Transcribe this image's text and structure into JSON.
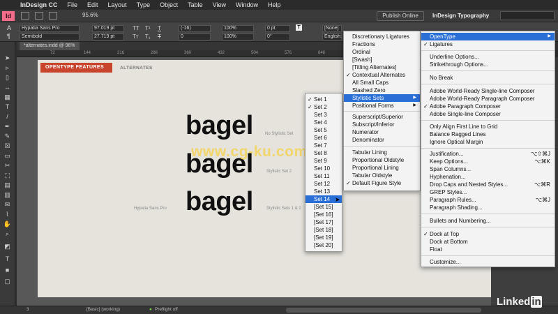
{
  "menubar": {
    "apple": "",
    "items": [
      "InDesign CC",
      "File",
      "Edit",
      "Layout",
      "Type",
      "Object",
      "Table",
      "View",
      "Window",
      "Help"
    ]
  },
  "toolbar": {
    "logo": "Id",
    "zoom": "95.6%",
    "publish_label": "Publish Online",
    "workspace_label": "InDesign Typography"
  },
  "control": {
    "font_family": "Hypatia Sans Pro",
    "font_style": "Semibold",
    "font_size": "97.019 pt",
    "leading": "27.719 pt",
    "kerning": "(-16)",
    "tracking": "0",
    "hscale": "100%",
    "vscale": "100%",
    "baseline": "0 pt",
    "skew": "0°",
    "char_style": "[None]",
    "language": "English: USA"
  },
  "document": {
    "tab_title": "*alternates.indd @ 96%",
    "ruler_marks": [
      "72",
      "144",
      "216",
      "288",
      "360",
      "432",
      "504",
      "576",
      "648",
      "720",
      "792",
      "864"
    ]
  },
  "page": {
    "section_tag": "OPENTYPE FEATURES",
    "section_title": "ALTERNATES",
    "sample_word": "bagel",
    "notes": {
      "row1": "No Stylistic Set",
      "row2": "Stylistic Set 2",
      "row3": "Stylistic Sets 1 & 2",
      "font_caption": "Hypatia Sans Pro"
    }
  },
  "menus": {
    "main": {
      "items": [
        {
          "label": "OpenType",
          "submenu": true,
          "highlighted": true
        },
        {
          "label": "Ligatures",
          "checked": true
        },
        {
          "sep": true
        },
        {
          "label": "Underline Options..."
        },
        {
          "label": "Strikethrough Options..."
        },
        {
          "sep": true
        },
        {
          "label": "No Break"
        },
        {
          "sep": true
        },
        {
          "label": "Adobe World-Ready Single-line Composer"
        },
        {
          "label": "Adobe World-Ready Paragraph Composer"
        },
        {
          "label": "Adobe Paragraph Composer",
          "checked": true
        },
        {
          "label": "Adobe Single-line Composer"
        },
        {
          "sep": true
        },
        {
          "label": "Only Align First Line to Grid"
        },
        {
          "label": "Balance Ragged Lines"
        },
        {
          "label": "Ignore Optical Margin"
        },
        {
          "sep": true
        },
        {
          "label": "Justification...",
          "shortcut": "⌥⇧⌘J"
        },
        {
          "label": "Keep Options...",
          "shortcut": "⌥⌘K"
        },
        {
          "label": "Span Columns..."
        },
        {
          "label": "Hyphenation..."
        },
        {
          "label": "Drop Caps and Nested Styles...",
          "shortcut": "⌥⌘R"
        },
        {
          "label": "GREP Styles..."
        },
        {
          "label": "Paragraph Rules...",
          "shortcut": "⌥⌘J"
        },
        {
          "label": "Paragraph Shading..."
        },
        {
          "sep": true
        },
        {
          "label": "Bullets and Numbering..."
        },
        {
          "sep": true
        },
        {
          "label": "Dock at Top",
          "checked": true
        },
        {
          "label": "Dock at Bottom"
        },
        {
          "label": "Float"
        },
        {
          "sep": true
        },
        {
          "label": "Customize..."
        }
      ]
    },
    "opentype": {
      "items": [
        {
          "label": "Discretionary Ligatures"
        },
        {
          "label": "Fractions"
        },
        {
          "label": "Ordinal"
        },
        {
          "label": "[Swash]"
        },
        {
          "label": "[Titling Alternates]"
        },
        {
          "label": "Contextual Alternates",
          "checked": true
        },
        {
          "label": "All Small Caps"
        },
        {
          "label": "Slashed Zero"
        },
        {
          "label": "Stylistic Sets",
          "submenu": true,
          "highlighted": true
        },
        {
          "label": "Positional Forms",
          "submenu": true
        },
        {
          "sep": true
        },
        {
          "label": "Superscript/Superior"
        },
        {
          "label": "Subscript/Inferior"
        },
        {
          "label": "Numerator"
        },
        {
          "label": "Denominator"
        },
        {
          "sep": true
        },
        {
          "label": "Tabular Lining"
        },
        {
          "label": "Proportional Oldstyle"
        },
        {
          "label": "Proportional Lining"
        },
        {
          "label": "Tabular Oldstyle"
        },
        {
          "label": "Default Figure Style",
          "checked": true
        }
      ]
    },
    "sets": {
      "items": [
        {
          "label": "Set 1",
          "checked": true
        },
        {
          "label": "Set 2",
          "checked": true
        },
        {
          "label": "Set 3"
        },
        {
          "label": "Set 4"
        },
        {
          "label": "Set 5"
        },
        {
          "label": "Set 6"
        },
        {
          "label": "Set 7"
        },
        {
          "label": "Set 8"
        },
        {
          "label": "Set 9"
        },
        {
          "label": "Set 10"
        },
        {
          "label": "Set 11"
        },
        {
          "label": "Set 12"
        },
        {
          "label": "Set 13"
        },
        {
          "label": "Set 14",
          "highlighted": true
        },
        {
          "label": "[Set 15]"
        },
        {
          "label": "[Set 16]"
        },
        {
          "label": "[Set 17]"
        },
        {
          "label": "[Set 18]"
        },
        {
          "label": "[Set 19]"
        },
        {
          "label": "[Set 20]"
        }
      ]
    }
  },
  "status": {
    "page_number": "3",
    "style_label": "[Basic] (working)",
    "preflight": "Preflight off"
  },
  "watermarks": {
    "linkedin_a": "Linked",
    "linkedin_b": "in",
    "cgku": "www.cg-ku.com"
  },
  "colors": {
    "accent": "#c8442c",
    "highlight": "#2a6fd6",
    "page": "#e5e3dc"
  }
}
